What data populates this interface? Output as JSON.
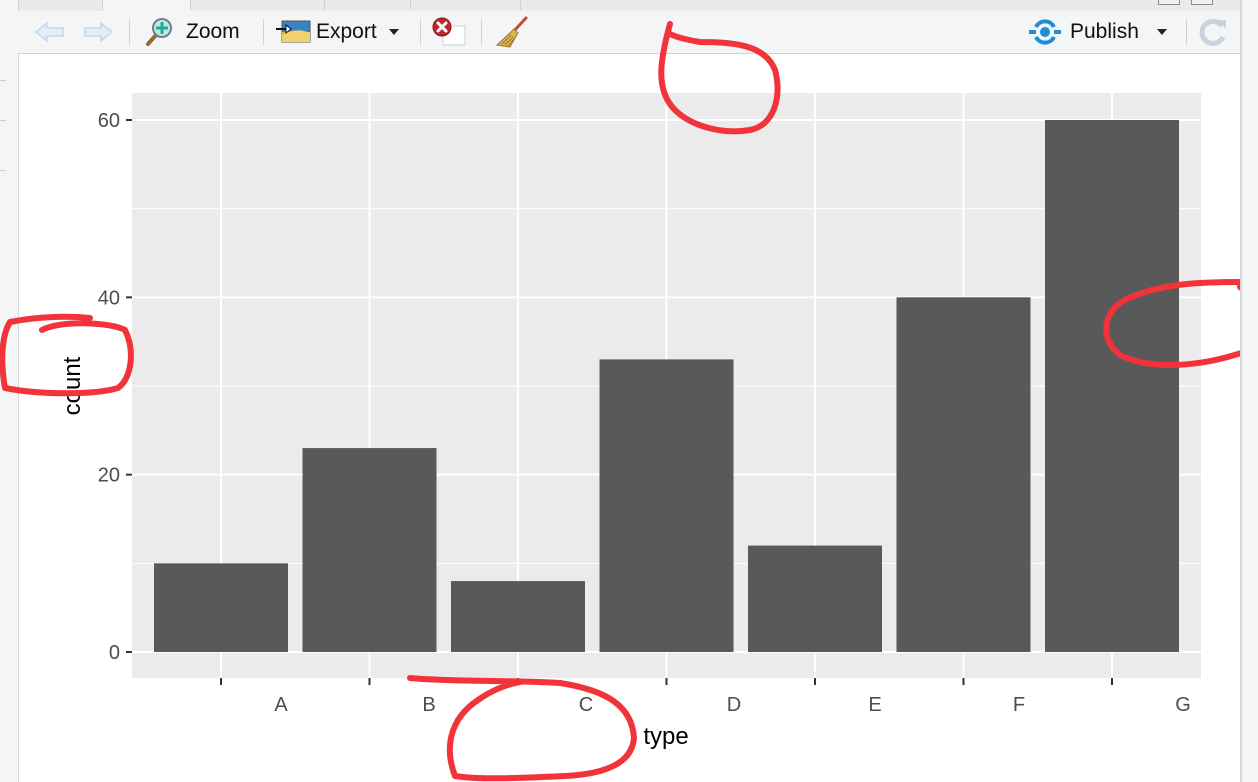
{
  "toolbar": {
    "back_label": "",
    "forward_label": "",
    "zoom_label": "Zoom",
    "export_label": "Export",
    "publish_label": "Publish",
    "icons": {
      "back": "arrow-left-icon",
      "forward": "arrow-right-icon",
      "zoom": "magnifier-plus-icon",
      "export": "image-export-icon",
      "remove": "remove-plot-icon",
      "clear": "broom-icon",
      "publish": "publish-icon",
      "refresh": "refresh-icon"
    }
  },
  "colors": {
    "bar_fill": "#595959",
    "panel_bg": "#ebebeb",
    "grid": "#ffffff",
    "annotation": "#f2333a",
    "publish_accent": "#1a8fd8"
  },
  "chart_data": {
    "type": "bar",
    "title": "",
    "xlabel": "type",
    "ylabel": "count",
    "categories": [
      "A",
      "B",
      "C",
      "D",
      "E",
      "F",
      "G"
    ],
    "values": [
      10,
      23,
      8,
      33,
      12,
      40,
      60
    ],
    "ylim": [
      -3,
      63
    ],
    "yticks": [
      0,
      20,
      40,
      60
    ],
    "ytick_labels": [
      "0",
      "20",
      "40",
      "60"
    ],
    "grid": true,
    "legend": "none"
  }
}
